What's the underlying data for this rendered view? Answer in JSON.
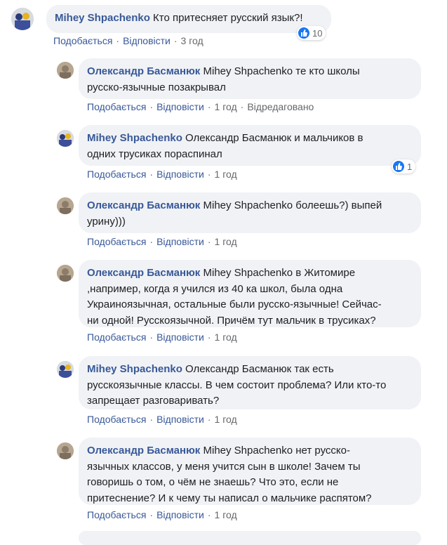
{
  "actions": {
    "like": "Подобається",
    "reply": "Відповісти",
    "sep": "·"
  },
  "comments": [
    {
      "author": "Mihey Shpachenko",
      "text": "Кто притесняет русский язык?!",
      "time": "3 год",
      "reactions": "10"
    },
    {
      "author": "Олександр Басманюк",
      "text_lines": [
        "Mihey Shpachenko те кто школы",
        "русско-язычные позакрывал"
      ],
      "time": "1 год",
      "edited": "Відредаговано"
    },
    {
      "author": "Mihey Shpachenko",
      "text_lines": [
        "Олександр Басманюк и мальчиков в",
        "одних трусиках пораспинал"
      ],
      "time": "1 год",
      "reactions": "1"
    },
    {
      "author": "Олександр Басманюк",
      "text_lines": [
        "Mihey Shpachenko болеешь?) выпей",
        "урину)))"
      ],
      "time": "1 год"
    },
    {
      "author": "Олександр Басманюк",
      "text_lines": [
        "Mihey Shpachenko в Житомире",
        ",например, когда я учился из 40 ка школ, была одна",
        "Украиноязычная, остальные были русско-язычные! Сейчас-",
        "ни одной! Русскоязычной. Причём тут мальчик в трусиках?"
      ],
      "time": "1 год"
    },
    {
      "author": "Mihey Shpachenko",
      "text_lines": [
        "Олександр Басманюк так есть",
        "русскоязычные классы. В чем состоит проблема? Или кто-то",
        "запрещает разговаривать?"
      ],
      "time": "1 год"
    },
    {
      "author": "Олександр Басманюк",
      "text_lines": [
        "Mihey Shpachenko нет русско-",
        "язычных классов, у меня учится сын в школе! Зачем ты",
        "говоришь о том, о чём не знаешь? Что это, если не",
        "притеснение? И к чему ты написал о мальчике распятом?"
      ],
      "time": "1 год"
    }
  ]
}
